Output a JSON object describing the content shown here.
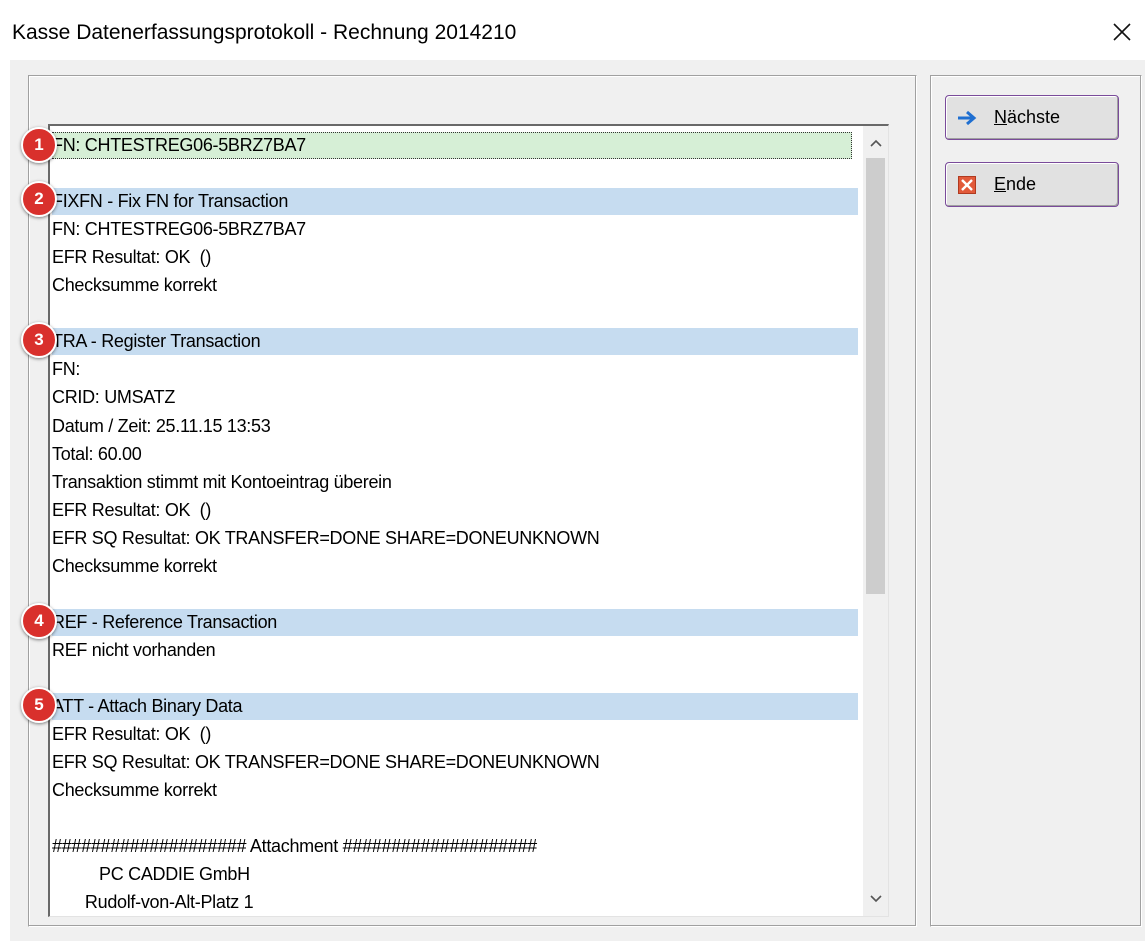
{
  "window": {
    "title": "Kasse Datenerfassungsprotokoll - Rechnung 2014210",
    "close_icon": "close-icon"
  },
  "buttons": {
    "next": {
      "label_first": "N",
      "label_rest": "ächste",
      "icon": "arrow-right-icon",
      "icon_color": "#1f6fd1"
    },
    "end": {
      "label_first": "E",
      "label_rest": "nde",
      "icon": "red-x-icon",
      "icon_color": "#e25a3a"
    }
  },
  "log": {
    "lines": [
      {
        "text": "FN: CHTESTREG06-5BRZ7BA7",
        "kind": "sel"
      },
      {
        "text": "",
        "kind": "text"
      },
      {
        "text": "FIXFN - Fix FN for Transaction",
        "kind": "head"
      },
      {
        "text": "FN: CHTESTREG06-5BRZ7BA7",
        "kind": "text"
      },
      {
        "text": "EFR Resultat: OK  ()",
        "kind": "text"
      },
      {
        "text": "Checksumme korrekt",
        "kind": "text"
      },
      {
        "text": "",
        "kind": "text"
      },
      {
        "text": "TRA - Register Transaction",
        "kind": "head"
      },
      {
        "text": "FN:",
        "kind": "text"
      },
      {
        "text": "CRID: UMSATZ",
        "kind": "text"
      },
      {
        "text": "Datum / Zeit: 25.11.15 13:53",
        "kind": "text"
      },
      {
        "text": "Total: 60.00",
        "kind": "text"
      },
      {
        "text": "Transaktion stimmt mit Kontoeintrag überein",
        "kind": "text"
      },
      {
        "text": "EFR Resultat: OK  ()",
        "kind": "text"
      },
      {
        "text": "EFR SQ Resultat: OK TRANSFER=DONE SHARE=DONEUNKNOWN",
        "kind": "text"
      },
      {
        "text": "Checksumme korrekt",
        "kind": "text"
      },
      {
        "text": "",
        "kind": "text"
      },
      {
        "text": "REF - Reference Transaction",
        "kind": "head"
      },
      {
        "text": "REF nicht vorhanden",
        "kind": "text"
      },
      {
        "text": "",
        "kind": "text"
      },
      {
        "text": "ATT - Attach Binary Data",
        "kind": "head"
      },
      {
        "text": "EFR Resultat: OK  ()",
        "kind": "text"
      },
      {
        "text": "EFR SQ Resultat: OK TRANSFER=DONE SHARE=DONEUNKNOWN",
        "kind": "text"
      },
      {
        "text": "Checksumme korrekt",
        "kind": "text"
      },
      {
        "text": "",
        "kind": "text"
      },
      {
        "text": "#################### Attachment ####################",
        "kind": "text"
      },
      {
        "text": "          PC CADDIE GmbH",
        "kind": "text"
      },
      {
        "text": "       Rudolf-von-Alt-Platz 1",
        "kind": "text"
      }
    ]
  },
  "badges": [
    "1",
    "2",
    "3",
    "4",
    "5"
  ],
  "colors": {
    "section_header_bg": "#c6dcf0",
    "selected_line_bg": "#d6efd6",
    "badge_red": "#d9302c",
    "window_bg": "#f0f0f0"
  }
}
